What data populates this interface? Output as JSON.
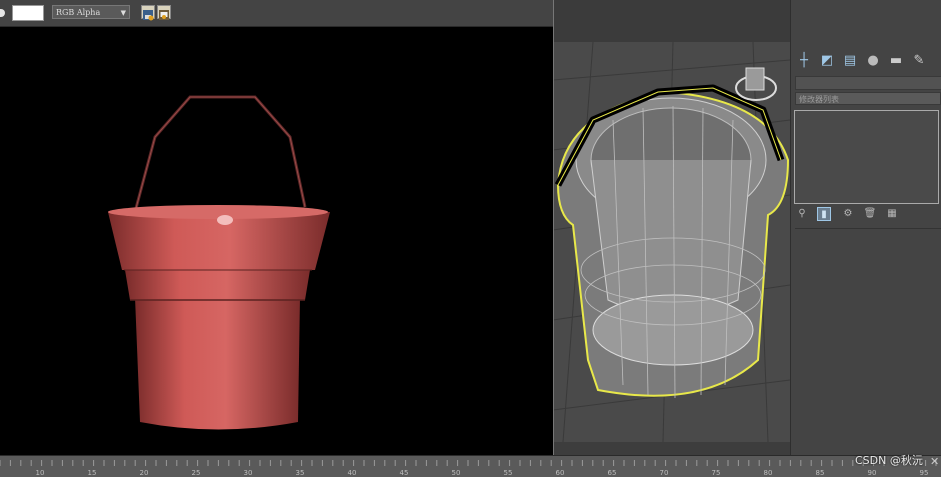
{
  "render_window": {
    "channel_select": "RGB Alpha",
    "toolbar_icons": [
      "save-image-icon",
      "clone-render-icon"
    ]
  },
  "command_panel": {
    "tabs": [
      "create-icon",
      "modify-icon",
      "hierarchy-icon",
      "motion-icon",
      "display-icon",
      "utilities-icon"
    ],
    "modifier_list_label": "修改器列表",
    "stack_tools": [
      "pin-stack-icon",
      "show-end-result-icon",
      "make-unique-icon",
      "remove-modifier-icon",
      "configure-sets-icon"
    ]
  },
  "timeline": {
    "tick_labels": [
      "10",
      "15",
      "20",
      "25",
      "30",
      "35",
      "40",
      "45",
      "50",
      "55",
      "60",
      "65",
      "70",
      "75",
      "80",
      "85",
      "90",
      "95"
    ]
  },
  "watermark": "CSDN @秋沅",
  "colors": {
    "bucket_red": "#cf5a57",
    "selection_yellow": "#e8e84a",
    "panel_accent": "#9fc7e6",
    "viewport_bg": "#4a4a4a"
  }
}
